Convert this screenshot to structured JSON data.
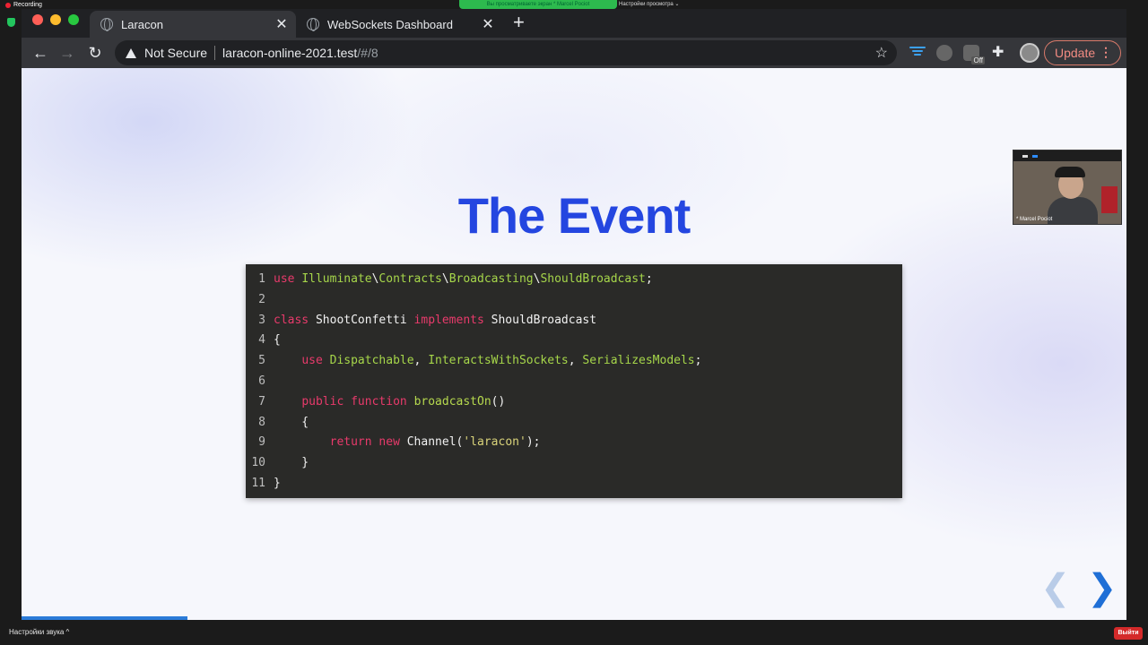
{
  "zoom": {
    "recording_label": "Recording",
    "share_banner": "Вы просматриваете экран * Marcel Pociot",
    "view_settings": "Настройки просмотра ⌄",
    "audio_settings": "Настройки звука  ^",
    "exit_label": "Выйти",
    "participant_name": "* Marcel Pociot"
  },
  "browser": {
    "tabs": [
      {
        "title": "Laracon",
        "active": true
      },
      {
        "title": "WebSockets Dashboard",
        "active": false
      }
    ],
    "new_tab": "+",
    "security_label": "Not Secure",
    "url_host": "laracon-online-2021.test",
    "url_path": "/#/8",
    "extension_badge": "Off",
    "update_label": "Update"
  },
  "slide": {
    "title": "The Event",
    "code_lines": [
      {
        "n": "1",
        "html_parts": [
          [
            "kw",
            "use"
          ],
          [
            "",
            " "
          ],
          [
            "ns",
            "Illuminate"
          ],
          [
            "",
            "\\"
          ],
          [
            "ns",
            "Contracts"
          ],
          [
            "",
            "\\"
          ],
          [
            "ns",
            "Broadcasting"
          ],
          [
            "",
            "\\"
          ],
          [
            "ns",
            "ShouldBroadcast"
          ],
          [
            "",
            ";"
          ]
        ]
      },
      {
        "n": "2",
        "html_parts": []
      },
      {
        "n": "3",
        "html_parts": [
          [
            "kw",
            "class"
          ],
          [
            "",
            " ShootConfetti "
          ],
          [
            "kw",
            "implements"
          ],
          [
            "",
            " ShouldBroadcast"
          ]
        ]
      },
      {
        "n": "4",
        "html_parts": [
          [
            "",
            "{"
          ]
        ]
      },
      {
        "n": "5",
        "html_parts": [
          [
            "",
            "    "
          ],
          [
            "kw",
            "use"
          ],
          [
            "",
            " "
          ],
          [
            "ns",
            "Dispatchable"
          ],
          [
            "",
            ", "
          ],
          [
            "ns",
            "InteractsWithSockets"
          ],
          [
            "",
            ", "
          ],
          [
            "ns",
            "SerializesModels"
          ],
          [
            "",
            ";"
          ]
        ]
      },
      {
        "n": "6",
        "html_parts": []
      },
      {
        "n": "7",
        "html_parts": [
          [
            "",
            "    "
          ],
          [
            "kw",
            "public"
          ],
          [
            "",
            " "
          ],
          [
            "kw",
            "function"
          ],
          [
            "",
            " "
          ],
          [
            "fn",
            "broadcastOn"
          ],
          [
            "",
            "()"
          ]
        ]
      },
      {
        "n": "8",
        "html_parts": [
          [
            "",
            "    {"
          ]
        ]
      },
      {
        "n": "9",
        "html_parts": [
          [
            "",
            "        "
          ],
          [
            "kw",
            "return"
          ],
          [
            "",
            " "
          ],
          [
            "kw",
            "new"
          ],
          [
            "",
            " Channel("
          ],
          [
            "st",
            "'laracon'"
          ],
          [
            "",
            ");"
          ]
        ]
      },
      {
        "n": "10",
        "html_parts": [
          [
            "",
            "    }"
          ]
        ]
      },
      {
        "n": "11",
        "html_parts": [
          [
            "",
            "}"
          ]
        ]
      }
    ],
    "progress_fraction": 0.15
  },
  "colors": {
    "title_blue": "#2446e0",
    "keyword": "#e83a6b",
    "identifier": "#a6d64a",
    "string": "#d9d37a",
    "update_red": "#f28b82"
  }
}
